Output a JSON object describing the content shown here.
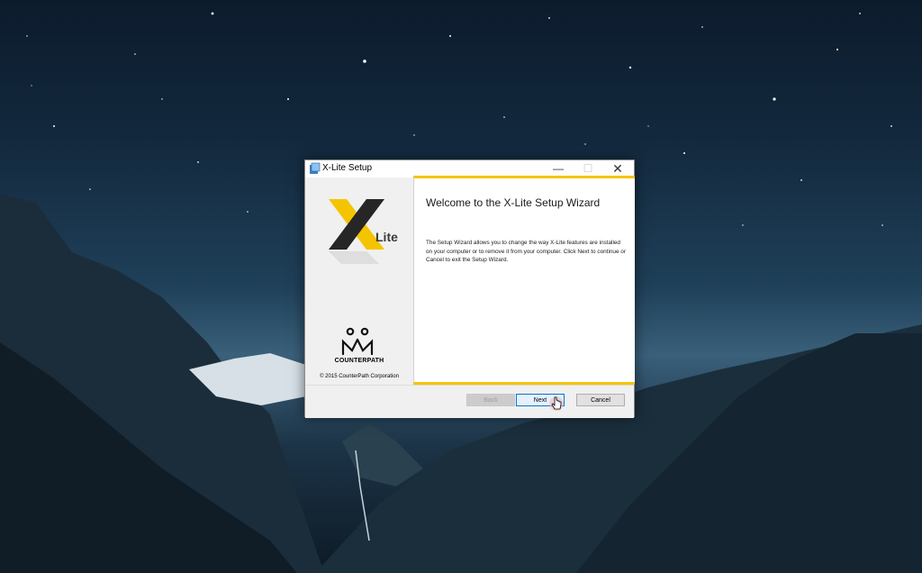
{
  "window": {
    "title": "X-Lite Setup",
    "minimize_glyph": "—",
    "maximize_glyph": "☐",
    "close_glyph": "✕"
  },
  "sidebar": {
    "logo_text": "Lite",
    "company_name": "CounterPath",
    "copyright": "© 2015 CounterPath Corporation"
  },
  "content": {
    "heading": "Welcome to the X-Lite Setup Wizard",
    "description": "The Setup Wizard allows you to change the way X-Lite features are installed on your computer or to remove it from your computer. Click Next to continue or Cancel to exit the Setup Wizard."
  },
  "buttons": {
    "back_label": "Back",
    "next_label": "Next",
    "cancel_label": "Cancel"
  },
  "colors": {
    "accent": "#f5c400",
    "focus": "#0078d7"
  }
}
